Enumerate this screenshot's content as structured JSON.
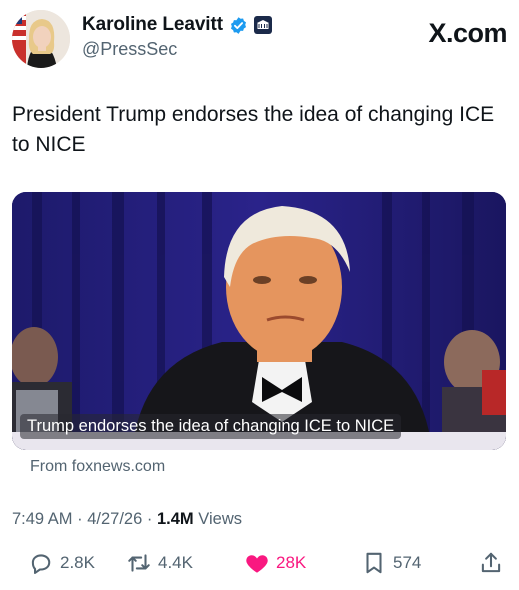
{
  "author": {
    "display_name": "Karoline Leavitt",
    "handle": "@PressSec",
    "verified": true,
    "affiliation_badge": "white-house-seal-icon"
  },
  "site_mark": "X.com",
  "tweet": {
    "text": "President Trump endorses the idea of changing ICE to NICE"
  },
  "card": {
    "caption": "Trump endorses the idea of changing ICE to NICE",
    "source": "From foxnews.com"
  },
  "meta": {
    "time": "7:49 AM",
    "date": "4/27/26",
    "views_count": "1.4M",
    "views_label": "Views",
    "separator": "·"
  },
  "actions": {
    "replies": "2.8K",
    "reposts": "4.4K",
    "likes": "28K",
    "bookmarks": "574"
  },
  "colors": {
    "text": "#0f1419",
    "secondary": "#536471",
    "like": "#f91880",
    "verified": "#1d9bf0"
  }
}
